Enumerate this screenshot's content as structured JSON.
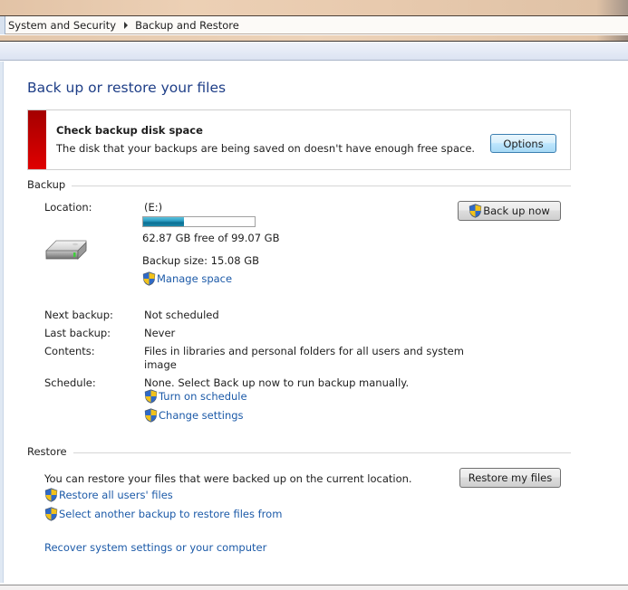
{
  "breadcrumb": {
    "items": [
      "System and Security",
      "Backup and Restore"
    ]
  },
  "page": {
    "title": "Back up or restore your files"
  },
  "alert": {
    "title": "Check backup disk space",
    "message": "The disk that your backups are being saved on doesn't have enough free space.",
    "button_label": "Options",
    "accent_color": "#cc0000"
  },
  "backup": {
    "section_label": "Backup",
    "location_label": "Location:",
    "location_value": "(E:)",
    "disk_used_fraction": 0.365,
    "free_space_text": "62.87 GB free of 99.07 GB",
    "backup_size_text": "Backup size: 15.08 GB",
    "manage_space_link": "Manage space",
    "back_up_now_button": "Back up now",
    "next_backup_label": "Next backup:",
    "next_backup_value": "Not scheduled",
    "last_backup_label": "Last backup:",
    "last_backup_value": "Never",
    "contents_label": "Contents:",
    "contents_value_line1": "Files in libraries and personal folders for all users and system",
    "contents_value_line2": "image",
    "schedule_label": "Schedule:",
    "schedule_value": "None. Select Back up now to run backup manually.",
    "turn_on_schedule_link": "Turn on schedule",
    "change_settings_link": "Change settings"
  },
  "restore": {
    "section_label": "Restore",
    "description": "You can restore your files that were backed up on the current location.",
    "restore_my_files_button": "Restore my files",
    "restore_all_users_link": "Restore all users' files",
    "select_another_backup_link": "Select another backup to restore files from",
    "recover_system_link": "Recover system settings or your computer"
  },
  "colors": {
    "link": "#1c5aa8",
    "title": "#1e3e87"
  }
}
